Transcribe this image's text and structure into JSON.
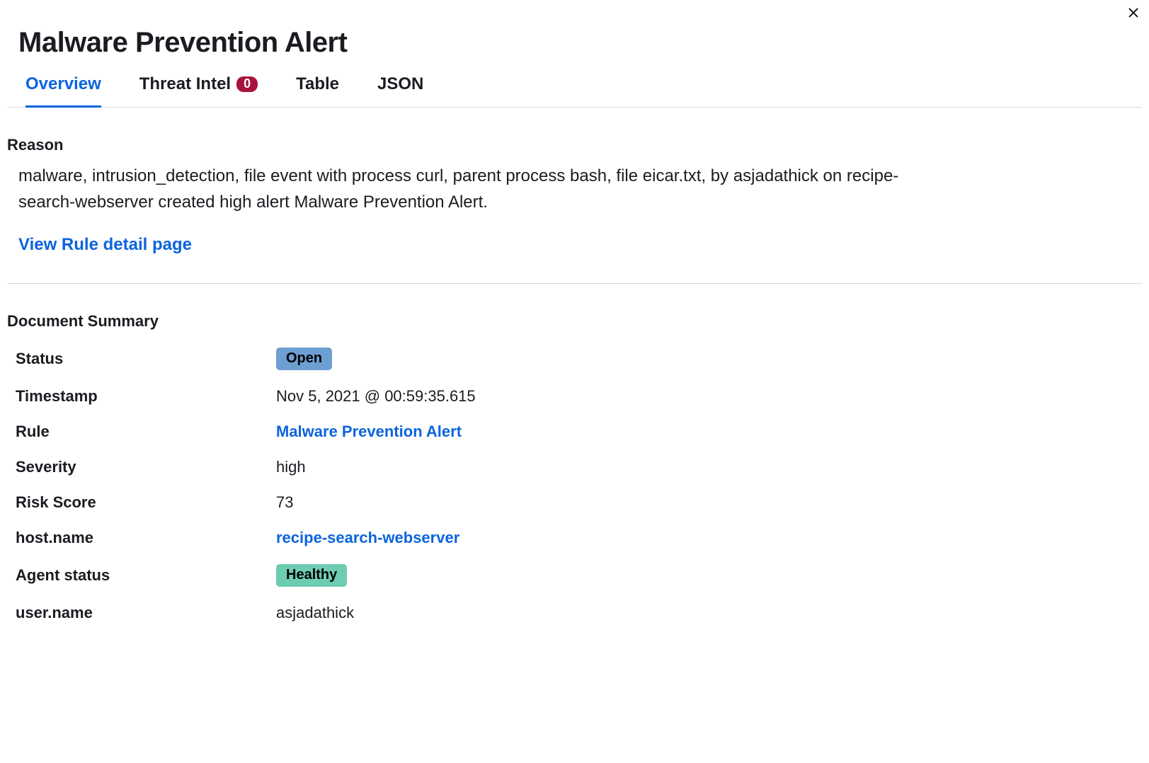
{
  "header": {
    "title": "Malware Prevention Alert"
  },
  "tabs": {
    "overview": "Overview",
    "threat_intel": "Threat Intel",
    "threat_intel_count": "0",
    "table": "Table",
    "json": "JSON"
  },
  "reason": {
    "heading": "Reason",
    "text": "malware, intrusion_detection, file event with process curl, parent process bash, file eicar.txt, by asjadathick on recipe-search-webserver created high alert Malware Prevention Alert.",
    "link": "View Rule detail page"
  },
  "summary": {
    "heading": "Document Summary",
    "rows": {
      "status": {
        "key": "Status",
        "value": "Open"
      },
      "timestamp": {
        "key": "Timestamp",
        "value": "Nov 5, 2021 @ 00:59:35.615"
      },
      "rule": {
        "key": "Rule",
        "value": "Malware Prevention Alert"
      },
      "severity": {
        "key": "Severity",
        "value": "high"
      },
      "risk_score": {
        "key": "Risk Score",
        "value": "73"
      },
      "host_name": {
        "key": "host.name",
        "value": "recipe-search-webserver"
      },
      "agent_status": {
        "key": "Agent status",
        "value": "Healthy"
      },
      "user_name": {
        "key": "user.name",
        "value": "asjadathick"
      }
    }
  }
}
